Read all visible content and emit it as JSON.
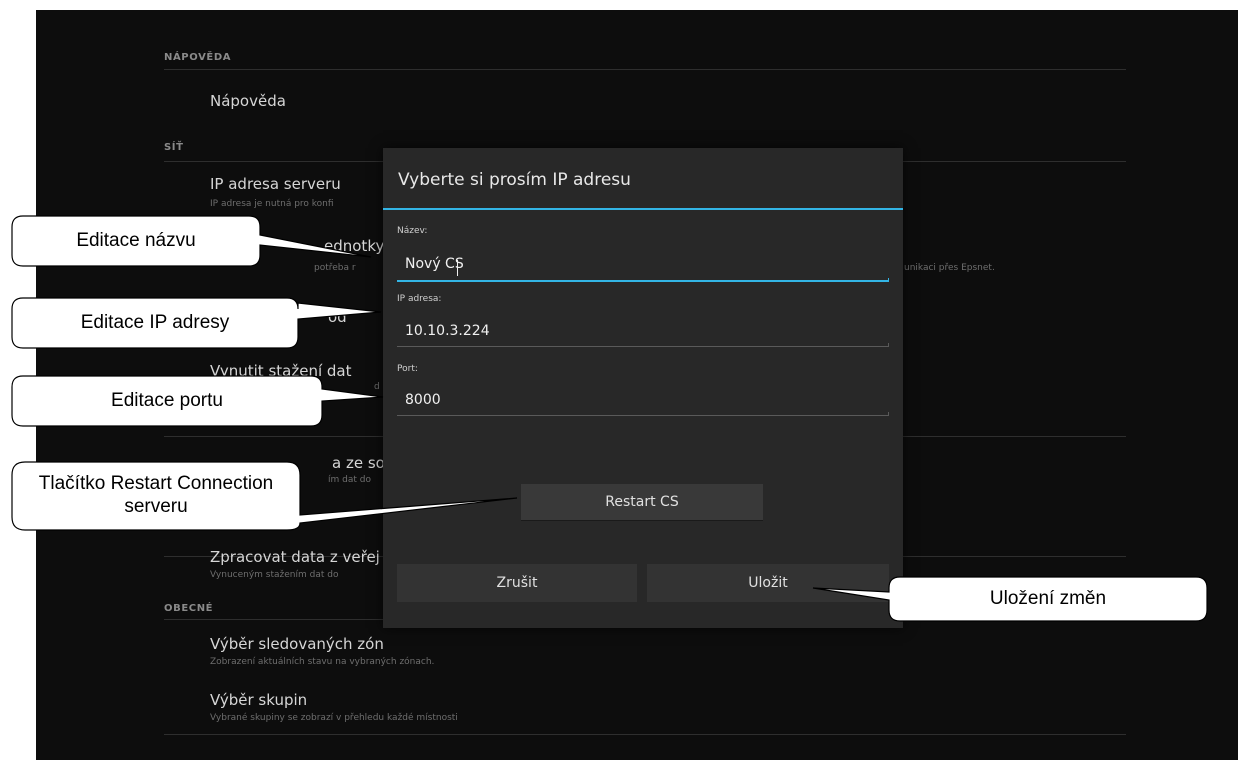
{
  "settings": {
    "help_section": "NÁPOVĚDA",
    "help_item": "Nápověda",
    "network_section": "SÍŤ",
    "ip_title": "IP adresa serveru",
    "ip_sub": "IP adresa je nutná pro konfi",
    "unit_title": "ednotky",
    "unit_sub": "potřeba r",
    "unit_sub_right": "unikaci přes Epsnet.",
    "item3_title": "od",
    "force_title": "Vynutit stažení dat",
    "force_sub": "d",
    "item5_title": "a ze sou",
    "item5_sub": "ím dat do",
    "public_title": "Zpracovat data z veřej",
    "public_sub": "Vynuceným stažením dat do",
    "general_section": "OBECNÉ",
    "zones_title": "Výběr sledovaných zón",
    "zones_sub": "Zobrazení aktuálních stavu na vybraných zónach.",
    "groups_title": "Výběr skupin",
    "groups_sub": "Vybrané skupiny se zobrazí v přehledu každé místnosti"
  },
  "dialog": {
    "title": "Vyberte si prosím IP adresu",
    "name_label": "Název:",
    "name_value": "Nový CS",
    "ip_label": "IP adresa:",
    "ip_value": "10.10.3.224",
    "port_label": "Port:",
    "port_value": "8000",
    "restart_label": "Restart CS",
    "cancel_label": "Zrušit",
    "save_label": "Uložit"
  },
  "callouts": {
    "name_edit": "Editace názvu",
    "ip_edit": "Editace IP adresy",
    "port_edit": "Editace portu",
    "restart": "Tlačítko Restart Connection serveru",
    "save": "Uložení změn"
  },
  "colors": {
    "background": "#0d0d0d",
    "dialog": "#282828",
    "accent": "#33b5e5"
  }
}
